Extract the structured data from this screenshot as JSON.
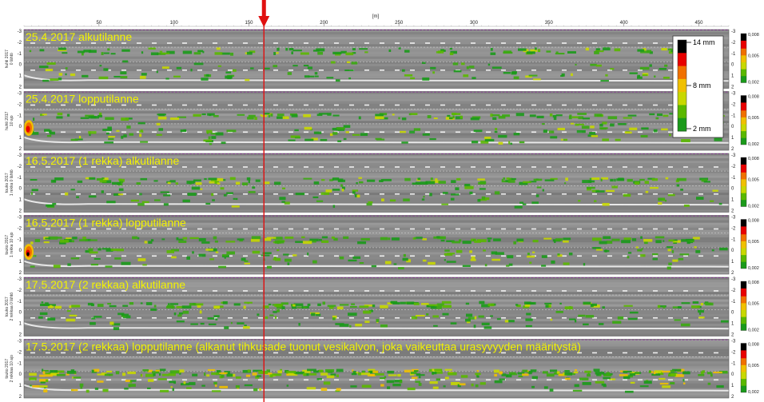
{
  "chart_data": {
    "type": "heatmap",
    "x_unit": "[m]",
    "xlim": [
      0,
      470
    ],
    "x_ticks": [
      50,
      100,
      150,
      200,
      250,
      300,
      350,
      400,
      450
    ],
    "y_ticks": [
      -3,
      -2,
      -1,
      0,
      1,
      2
    ],
    "marker_x": 160,
    "legend": {
      "labels": [
        "14 mm",
        "8 mm",
        "2 mm"
      ],
      "colors": [
        "#000000",
        "#e80000",
        "#f07000",
        "#f0c000",
        "#c8d800",
        "#5ab800",
        "#1a9a1a"
      ]
    },
    "colorbar_labels": [
      "0,008",
      "0,005",
      "0,002"
    ],
    "panels": [
      {
        "title": "25.4.2017 alkutilanne",
        "side_label": [
          "huhti 2017",
          "0 lähtö"
        ],
        "intensity": 0.35,
        "band_row": 0.35
      },
      {
        "title": "25.4.2017 lopputilanne",
        "side_label": [
          "huhti 2017",
          "10 ajo"
        ],
        "intensity": 0.45,
        "band_row": 0.4
      },
      {
        "title": "16.5.2017 (1 rekka) alkutilanne",
        "side_label": [
          "touko 2017",
          "1 rekka 0 lähtö"
        ],
        "intensity": 0.4,
        "band_row": 0.45
      },
      {
        "title": "16.5.2017 (1 rekka) lopputilanne",
        "side_label": [
          "touko 2017",
          "1 rekka 10 ajo"
        ],
        "intensity": 0.45,
        "band_row": 0.4
      },
      {
        "title": "17.5.2017 (2 rekkaa) alkutilanne",
        "side_label": [
          "touko 2017",
          "2 rekkaa 0 lähtö"
        ],
        "intensity": 0.4,
        "band_row": 0.45
      },
      {
        "title": "17.5.2017 (2 rekkaa) lopputilanne (alkanut tihkusade tuonut vesikalvon, joka vaikeuttaa urasyvyyden määritystä)",
        "side_label": [
          "touko 2017",
          "2 rekkaa 10 ajo"
        ],
        "intensity": 0.8,
        "band_row": 0.55
      }
    ]
  }
}
